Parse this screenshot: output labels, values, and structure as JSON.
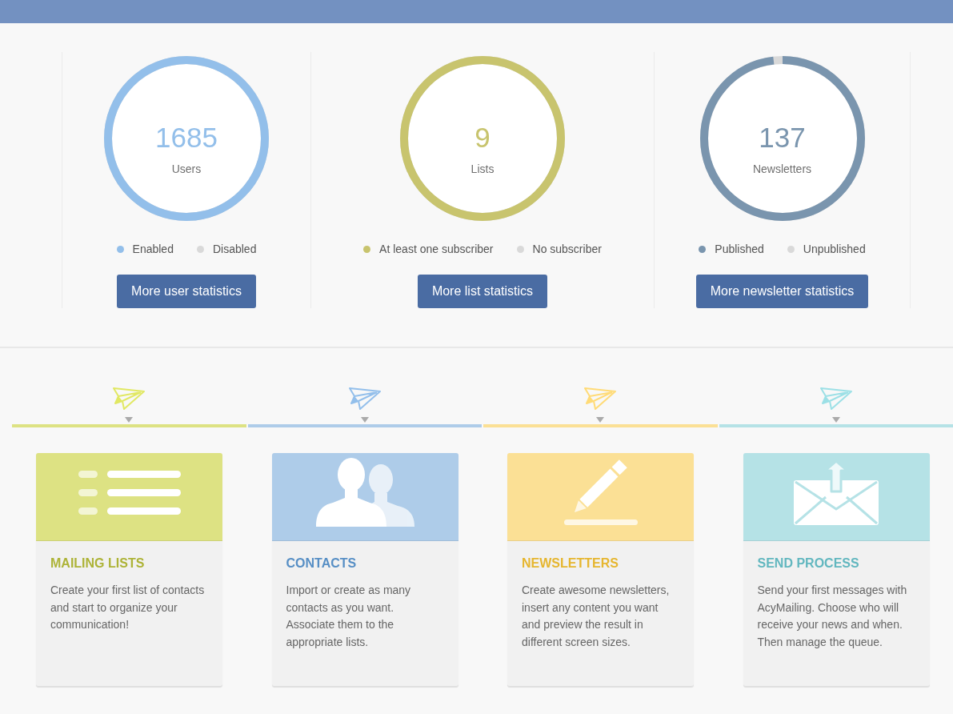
{
  "stats": [
    {
      "number": "1685",
      "label": "Users",
      "level": 1,
      "legend": [
        {
          "label": "Enabled",
          "color": "#93bfea"
        },
        {
          "label": "Disabled",
          "color": "#d9d9d9"
        }
      ],
      "button": "More user statistics"
    },
    {
      "number": "9",
      "label": "Lists",
      "level": 1,
      "legend": [
        {
          "label": "At least one subscriber",
          "color": "#c8c46e"
        },
        {
          "label": "No subscriber",
          "color": "#d9d9d9"
        }
      ],
      "button": "More list statistics"
    },
    {
      "number": "137",
      "label": "Newsletters",
      "level": 0.98,
      "legend": [
        {
          "label": "Published",
          "color": "#7a95ae"
        },
        {
          "label": "Unpublished",
          "color": "#d9d9d9"
        }
      ],
      "button": "More newsletter statistics"
    }
  ],
  "steps": [
    {
      "kind": "lists",
      "color": "#dde283",
      "title": "MAILING LISTS",
      "description": "Create your first list of contacts and start to organize your communication!"
    },
    {
      "kind": "contacts",
      "color": "#aecce9",
      "title": "CONTACTS",
      "description": "Import or create as many contacts as you want. Associate them to the appropriate lists."
    },
    {
      "kind": "newsletters",
      "color": "#fbe095",
      "title": "NEWSLETTERS",
      "description": "Create awesome newsletters, insert any content you want and preview the result in different screen sizes."
    },
    {
      "kind": "sending",
      "color": "#b5e2e6",
      "title": "SEND PROCESS",
      "description": "Send your first messages with AcyMailing. Choose who will receive your news and when. Then manage the queue."
    }
  ]
}
